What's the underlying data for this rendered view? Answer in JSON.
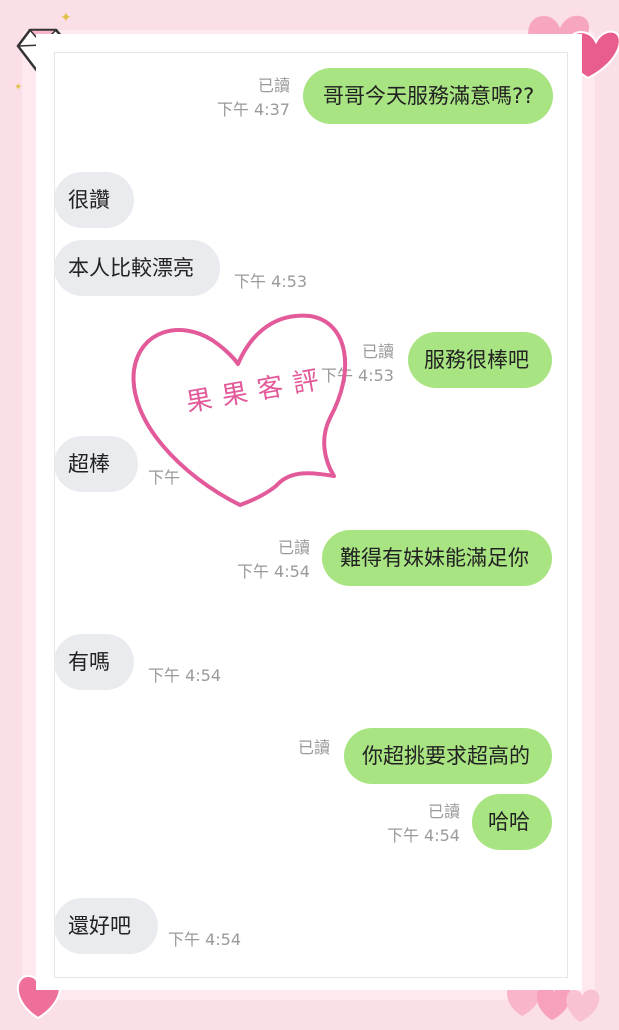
{
  "stamp": {
    "text": "果果客評",
    "color": "#e25a99"
  },
  "colors": {
    "outgoing_bubble": "#a9e483",
    "incoming_bubble": "#e9ebee",
    "meta_text": "#9a9a9a"
  },
  "messages": [
    {
      "side": "outgoing",
      "text": "哥哥今天服務滿意嗎??",
      "read": "已讀",
      "time": "下午 4:37"
    },
    {
      "side": "incoming",
      "text": "很讚",
      "time": ""
    },
    {
      "side": "incoming",
      "text": "本人比較漂亮",
      "time": "下午 4:53"
    },
    {
      "side": "outgoing",
      "text": "服務很棒吧",
      "read": "已讀",
      "time": "下午 4:53"
    },
    {
      "side": "incoming",
      "text": "超棒",
      "time": "下午"
    },
    {
      "side": "outgoing",
      "text": "難得有妹妹能滿足你",
      "read": "已讀",
      "time": "下午 4:54"
    },
    {
      "side": "incoming",
      "text": "有嗎",
      "time": "下午 4:54"
    },
    {
      "side": "outgoing",
      "text": "你超挑要求超高的",
      "read": "已讀",
      "time": ""
    },
    {
      "side": "outgoing",
      "text": "哈哈",
      "read": "已讀",
      "time": "下午 4:54"
    },
    {
      "side": "incoming",
      "text": "還好吧",
      "time": "下午 4:54"
    }
  ]
}
